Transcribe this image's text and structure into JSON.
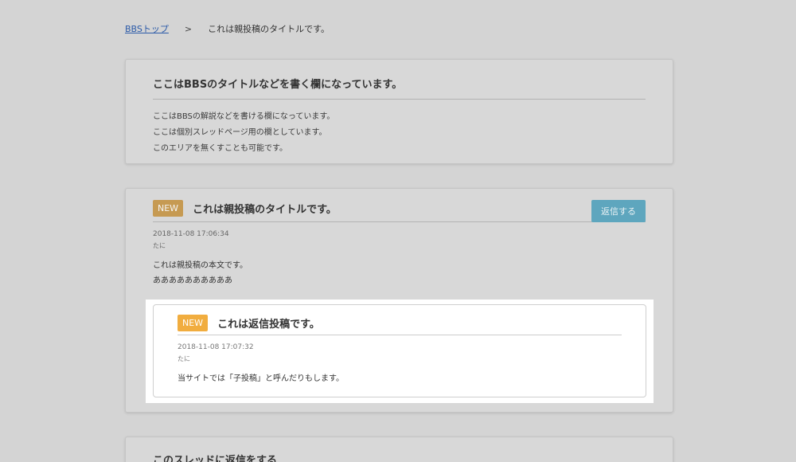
{
  "breadcrumb": {
    "home": "BBSトップ",
    "separator": ">",
    "current": "これは親投稿のタイトルです。"
  },
  "intro": {
    "title": "ここはBBSのタイトルなどを書く欄になっています。",
    "lines": [
      "ここはBBSの解説などを書ける欄になっています。",
      "ここは個別スレッドページ用の欄としています。",
      "このエリアを無くすことも可能です。"
    ]
  },
  "parent_post": {
    "badge": "NEW",
    "title": "これは親投稿のタイトルです。",
    "reply_button": "返信する",
    "date": "2018-11-08 17:06:34",
    "author": "たに",
    "body_lines": [
      "これは親投稿の本文です。",
      "ああああああああああ"
    ]
  },
  "reply_post": {
    "badge": "NEW",
    "title": "これは返信投稿です。",
    "date": "2018-11-08 17:07:32",
    "author": "たに",
    "body": "当サイトでは「子投稿」と呼んだりもします。"
  },
  "reply_form": {
    "title": "このスレッドに返信をする"
  },
  "colors": {
    "accent_badge": "#f1ad3f",
    "reply_button": "#5ea6be",
    "link": "#2b5aa8"
  }
}
